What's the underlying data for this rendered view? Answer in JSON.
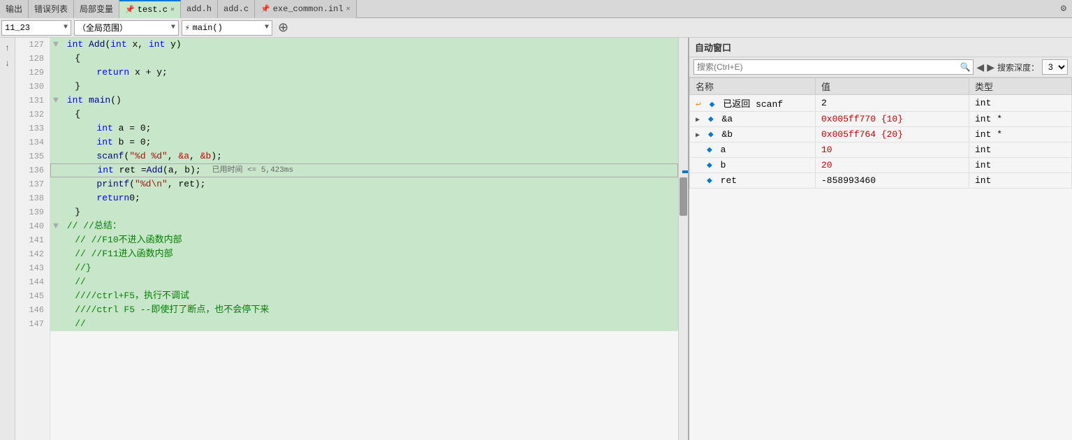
{
  "tabs": {
    "items": [
      {
        "label": "输出",
        "active": false,
        "closable": false
      },
      {
        "label": "错误列表",
        "active": false,
        "closable": false
      },
      {
        "label": "局部变量",
        "active": false,
        "closable": false
      },
      {
        "label": "test.c",
        "active": true,
        "closable": true,
        "pinned": true
      },
      {
        "label": "add.h",
        "active": false,
        "closable": false
      },
      {
        "label": "add.c",
        "active": false,
        "closable": false
      },
      {
        "label": "exe_common.inl",
        "active": false,
        "closable": true,
        "pinned": true
      }
    ],
    "settings_icon": "⚙"
  },
  "toolbar": {
    "location_value": "11_23",
    "scope_value": "（全局范围）",
    "function_value": "main()",
    "expand_icon": "⊕"
  },
  "code": {
    "lines": [
      {
        "num": 127,
        "text": "int Add(int x, int y)",
        "bg": "green"
      },
      {
        "num": 128,
        "text": "    {",
        "bg": "green"
      },
      {
        "num": 129,
        "text": "        return x + y;",
        "bg": "green"
      },
      {
        "num": 130,
        "text": "    }",
        "bg": "green"
      },
      {
        "num": 131,
        "text": "int main()",
        "bg": "green"
      },
      {
        "num": 132,
        "text": "    {",
        "bg": "green"
      },
      {
        "num": 133,
        "text": "        int a = 0;",
        "bg": "green"
      },
      {
        "num": 134,
        "text": "        int b = 0;",
        "bg": "green"
      },
      {
        "num": 135,
        "text": "        scanf(\"%d %d\", &a, &b);",
        "bg": "green"
      },
      {
        "num": 136,
        "text": "        int ret = Add(a, b);",
        "bg": "current",
        "arrow": true,
        "tooltip": "已用时间 <= 5,423ms"
      },
      {
        "num": 137,
        "text": "        printf(\"%d\\n\", ret);",
        "bg": "green"
      },
      {
        "num": 138,
        "text": "        return 0;",
        "bg": "green"
      },
      {
        "num": 139,
        "text": "    }",
        "bg": "green"
      },
      {
        "num": 140,
        "text": "//  //总结：",
        "bg": "green"
      },
      {
        "num": 141,
        "text": "    //  //F10不进入函数内部",
        "bg": "green"
      },
      {
        "num": 142,
        "text": "    //  //F11进入函数内部",
        "bg": "green"
      },
      {
        "num": 143,
        "text": "    //}",
        "bg": "green"
      },
      {
        "num": 144,
        "text": "    //",
        "bg": "green"
      },
      {
        "num": 145,
        "text": "    ////ctrl+F5，执行不调试",
        "bg": "green"
      },
      {
        "num": 146,
        "text": "    ////ctrl F5 --即使打了断点，也不会停下来",
        "bg": "green"
      },
      {
        "num": 147,
        "text": "    //",
        "bg": "green"
      }
    ]
  },
  "auto_window": {
    "title": "自动窗口",
    "search_placeholder": "搜索(Ctrl+E)",
    "depth_label": "搜索深度：",
    "depth_value": "3",
    "columns": [
      "名称",
      "值",
      "类型"
    ],
    "variables": [
      {
        "name": "已返回 scanf",
        "value": "2",
        "type": "int",
        "icon": "returned",
        "expandable": false,
        "indent": 0
      },
      {
        "name": "&a",
        "value": "0x005ff770 {10}",
        "type": "int *",
        "icon": "var",
        "expandable": true,
        "indent": 0
      },
      {
        "name": "&b",
        "value": "0x005ff764 {20}",
        "type": "int *",
        "icon": "var",
        "expandable": true,
        "indent": 0
      },
      {
        "name": "a",
        "value": "10",
        "type": "int",
        "icon": "var",
        "expandable": false,
        "indent": 0
      },
      {
        "name": "b",
        "value": "20",
        "type": "int",
        "icon": "var",
        "expandable": false,
        "indent": 0
      },
      {
        "name": "ret",
        "value": "-858993460",
        "type": "int",
        "icon": "var",
        "expandable": false,
        "indent": 0
      }
    ]
  }
}
